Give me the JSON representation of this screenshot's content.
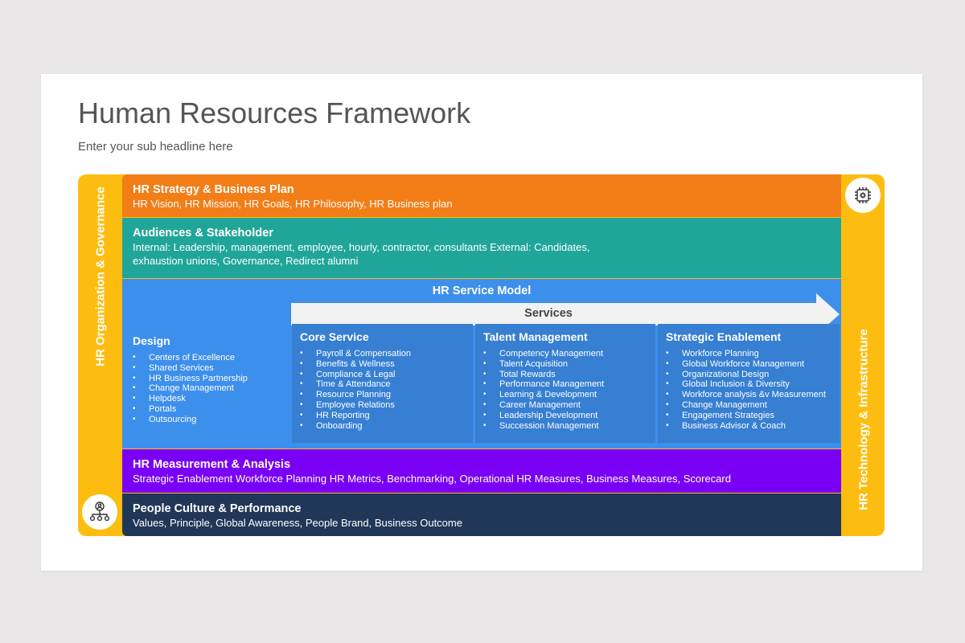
{
  "header": {
    "title": "Human Resources Framework",
    "subtitle": "Enter your sub headline here"
  },
  "side": {
    "left_label": "HR Organization & Governance",
    "right_label": "HR Technology & Infrastructure"
  },
  "strategy": {
    "title": "HR Strategy & Business Plan",
    "text": "HR Vision, HR Mission, HR Goals, HR Philosophy, HR Business plan"
  },
  "audiences": {
    "title": "Audiences & Stakeholder",
    "line1": "Internal: Leadership, management, employee, hourly, contractor, consultants External: Candidates,",
    "line2": "exhaustion unions, Governance, Redirect alumni"
  },
  "service_model": {
    "title": "HR Service Model",
    "arrow_label": "Services",
    "design": {
      "title": "Design",
      "items": [
        "Centers of Excellence",
        "Shared Services",
        "HR Business Partnership",
        "Change Management",
        "Helpdesk",
        "Portals",
        "Outsourcing"
      ]
    },
    "columns": [
      {
        "title": "Core Service",
        "items": [
          "Payroll & Compensation",
          "Benefits & Wellness",
          "Compliance & Legal",
          "Time & Attendance",
          "Resource Planning",
          "Employee Relations",
          "HR Reporting",
          "Onboarding"
        ]
      },
      {
        "title": "Talent Management",
        "items": [
          "Competency Management",
          "Talent Acquisition",
          "Total Rewards",
          "Performance Management",
          "Learning & Development",
          "Career Management",
          "Leadership Development",
          "Succession Management"
        ]
      },
      {
        "title": "Strategic Enablement",
        "items": [
          "Workforce Planning",
          "Global Workforce Management",
          "Organizational Design",
          "Global Inclusion & Diversity",
          "Workforce analysis &v Measurement",
          "Change Management",
          "Engagement Strategies",
          " Business Advisor & Coach"
        ]
      }
    ]
  },
  "measurement": {
    "title": "HR Measurement & Analysis",
    "text": "Strategic Enablement Workforce Planning HR Metrics, Benchmarking, Operational HR Measures, Business Measures, Scorecard"
  },
  "culture": {
    "title": "People Culture & Performance",
    "text": "Values, Principle, Global Awareness, People Brand, Business Outcome"
  },
  "colors": {
    "frame": "#fdbd10",
    "strategy": "#f37d17",
    "audiences": "#20a698",
    "service_model": "#3d8fec",
    "measurement": "#7a00f5",
    "culture": "#213758"
  },
  "icons": {
    "right": "cpu-chip-gear-icon",
    "left": "org-chart-person-icon"
  }
}
